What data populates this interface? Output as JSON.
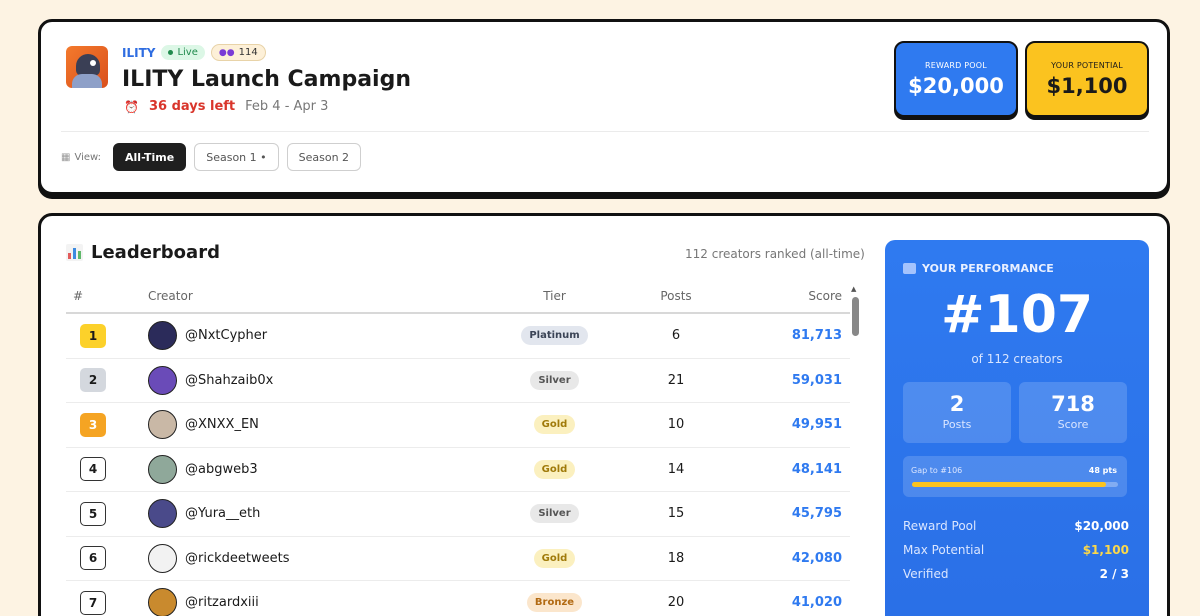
{
  "header": {
    "brand": "ILITY",
    "live_label": "Live",
    "participant_count": "114",
    "title": "ILITY Launch Campaign",
    "days_left": "36 days left",
    "date_range": "Feb 4 - Apr 3",
    "view_label": "View:",
    "view_options": [
      "All-Time",
      "Season 1 •",
      "Season 2"
    ],
    "active_view": "All-Time"
  },
  "reward_pool": {
    "label": "REWARD POOL",
    "value": "$20,000",
    "color": "#2f7af0"
  },
  "your_potential": {
    "label": "YOUR POTENTIAL",
    "value": "$1,100",
    "color": "#fbc31f"
  },
  "leaderboard": {
    "title": "Leaderboard",
    "subtitle": "112 creators ranked (all-time)",
    "columns": [
      "#",
      "Creator",
      "Tier",
      "Posts",
      "Score"
    ],
    "rows": [
      {
        "rank": "1",
        "handle": "@NxtCypher",
        "tier": "Platinum",
        "posts": "6",
        "score": "81,713",
        "avatar_color": "#2b2b5a"
      },
      {
        "rank": "2",
        "handle": "@Shahzaib0x",
        "tier": "Silver",
        "posts": "21",
        "score": "59,031",
        "avatar_color": "#6a4bb8"
      },
      {
        "rank": "3",
        "handle": "@XNXX_EN",
        "tier": "Gold",
        "posts": "10",
        "score": "49,951",
        "avatar_color": "#c9b8a6"
      },
      {
        "rank": "4",
        "handle": "@abgweb3",
        "tier": "Gold",
        "posts": "14",
        "score": "48,141",
        "avatar_color": "#8fa89a"
      },
      {
        "rank": "5",
        "handle": "@Yura__eth",
        "tier": "Silver",
        "posts": "15",
        "score": "45,795",
        "avatar_color": "#4a4a8a"
      },
      {
        "rank": "6",
        "handle": "@rickdeetweets",
        "tier": "Gold",
        "posts": "18",
        "score": "42,080",
        "avatar_color": "#f2f2f2"
      },
      {
        "rank": "7",
        "handle": "@ritzardxiii",
        "tier": "Bronze",
        "posts": "20",
        "score": "41,020",
        "avatar_color": "#c98a2e"
      }
    ]
  },
  "performance": {
    "title": "YOUR PERFORMANCE",
    "rank": "#107",
    "of_label": "of 112 creators",
    "posts_value": "2",
    "posts_label": "Posts",
    "score_value": "718",
    "score_label": "Score",
    "gap_label": "Gap to #106",
    "gap_points": "48 pts",
    "gap_progress": 0.94,
    "reward_pool_label": "Reward Pool",
    "reward_pool_value": "$20,000",
    "max_potential_label": "Max Potential",
    "max_potential_value": "$1,100",
    "verified_label": "Verified",
    "verified_value": "2 / 3"
  }
}
